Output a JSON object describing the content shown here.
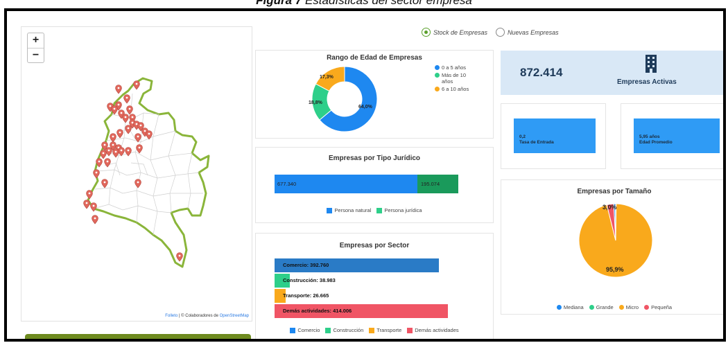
{
  "caption": {
    "figure": "Figura 7",
    "text": "Estadísticas del sector empresa"
  },
  "map": {
    "zoom_in": "+",
    "zoom_out": "−",
    "attribution_leaflet": "Folleto",
    "attribution_sep": " | © Colaboradores de ",
    "attribution_osm": "OpenStreetMap"
  },
  "toggle": {
    "options": [
      {
        "label": "Stock de Empresas",
        "selected": true
      },
      {
        "label": "Nuevas Empresas",
        "selected": false
      }
    ]
  },
  "age_chart": {
    "title": "Rango de Edad de Empresas",
    "legend": [
      "0 a 5 años",
      "Más de 10 años",
      "6 a 10 años"
    ],
    "labels": [
      "64,0%",
      "18,8%",
      "17,3%"
    ]
  },
  "legal_chart": {
    "title": "Empresas por Tipo Jurídico",
    "bar_labels": [
      "677.340",
      "195.074"
    ],
    "legend": [
      "Persona natural",
      "Persona jurídica"
    ]
  },
  "sector_chart": {
    "title": "Empresas por Sector",
    "bar_labels": [
      "Comercio: 392.760",
      "Construcción: 38.983",
      "Transporte: 26.665",
      "Demás actividades: 414.006"
    ],
    "legend": [
      "Comercio",
      "Construcción",
      "Transporte",
      "Demás actividades"
    ]
  },
  "kpi": {
    "value": "872.414",
    "label": "Empresas Activas",
    "icon": "building-icon",
    "entry_rate_value": "0,2",
    "entry_rate_label": "Tasa de Entrada",
    "avg_age_value": "5,95 años",
    "avg_age_label": "Edad Promedio"
  },
  "size_chart": {
    "title": "Empresas por Tamaño",
    "labels": [
      "3,0%",
      "95,9%"
    ],
    "legend": [
      "Mediana",
      "Grande",
      "Micro",
      "Pequeña"
    ]
  },
  "colors": {
    "blue": "#1e88f0",
    "green": "#2ecf8a",
    "orange": "#f9a91c",
    "red": "#f05565",
    "dark_blue": "#2a7bc6",
    "dark_green": "#1a9a5b",
    "kpi_blue": "#2f9bf5",
    "map_outline": "#8ab53a"
  },
  "chart_data": [
    {
      "type": "pie",
      "title": "Rango de Edad de Empresas",
      "categories": [
        "0 a 5 años",
        "Más de 10 años",
        "6 a 10 años"
      ],
      "values": [
        64.0,
        18.8,
        17.3
      ],
      "legend": "right"
    },
    {
      "type": "bar",
      "title": "Empresas por Tipo Jurídico",
      "categories": [
        "Persona natural",
        "Persona jurídica"
      ],
      "values": [
        677340,
        195074
      ],
      "legend": "bottom"
    },
    {
      "type": "bar",
      "title": "Empresas por Sector",
      "categories": [
        "Comercio",
        "Construcción",
        "Transporte",
        "Demás actividades"
      ],
      "values": [
        392760,
        38983,
        26665,
        414006
      ],
      "legend": "bottom"
    },
    {
      "type": "pie",
      "title": "Empresas por Tamaño",
      "categories": [
        "Mediana",
        "Grande",
        "Micro",
        "Pequeña"
      ],
      "values": [
        0.8,
        0.3,
        95.9,
        3.0
      ],
      "legend": "bottom"
    }
  ]
}
